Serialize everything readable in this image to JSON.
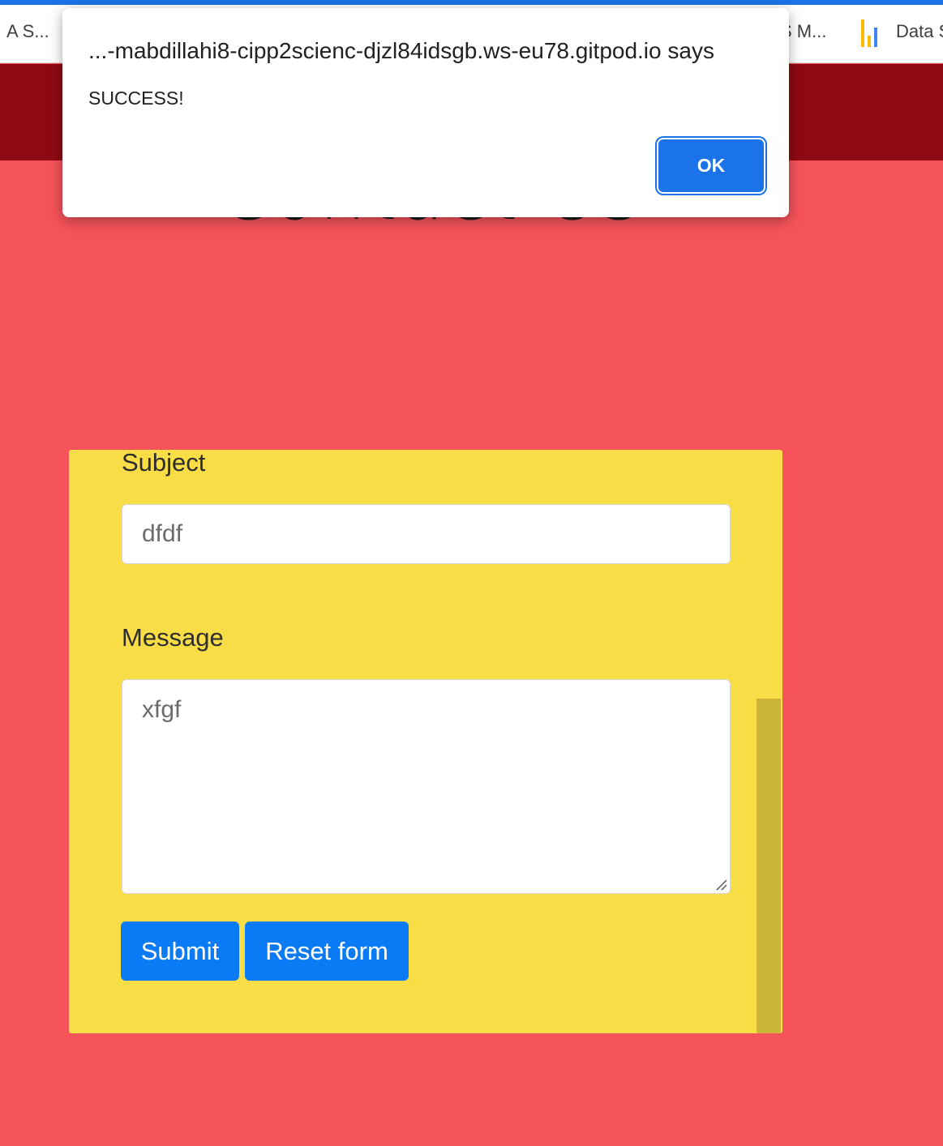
{
  "bookmarks": {
    "items": [
      {
        "label": "A S..."
      },
      {
        "label": "S M..."
      },
      {
        "label": "Data S"
      }
    ]
  },
  "page": {
    "heading": "Contact Us"
  },
  "form": {
    "subject_label": "Subject",
    "subject_value": "dfdf",
    "message_label": "Message",
    "message_value": "xfgf",
    "submit_label": "Submit",
    "reset_label": "Reset form"
  },
  "dialog": {
    "title": "...-mabdillahi8-cipp2scienc-djzl84idsgb.ws-eu78.gitpod.io says",
    "message": "SUCCESS!",
    "ok_label": "OK"
  },
  "colors": {
    "page_bg": "#f5535a",
    "header_bg": "#8e0a13",
    "card_bg": "#f9dd47",
    "button_blue": "#0a7bf5",
    "dialog_ok": "#1a73e8"
  }
}
